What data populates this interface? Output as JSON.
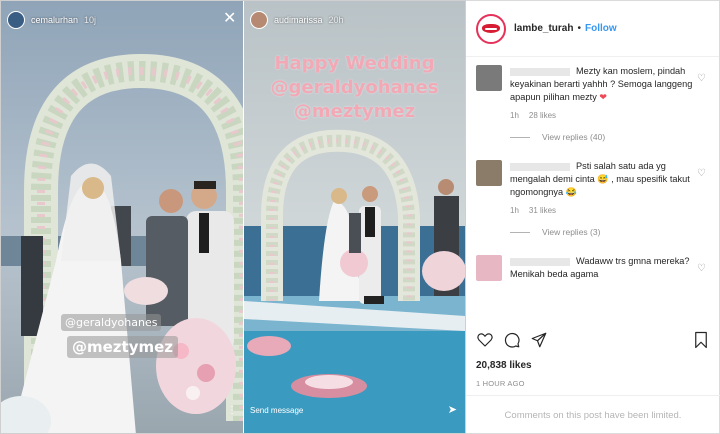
{
  "story_left": {
    "username": "cemalurhan",
    "time": "10j",
    "tag_1": "@geraldyohanes",
    "tag_2": "@meztymez"
  },
  "story_right": {
    "username": "audimarissa",
    "time": "20h",
    "caption_1": "Happy Wedding",
    "caption_2": "@geraldyohanes",
    "caption_3": "@meztymez",
    "send_message": "Send message"
  },
  "post_header": {
    "username": "lambe_turah",
    "separator": "•",
    "follow": "Follow"
  },
  "comments": [
    {
      "text_1": "Mezty kan moslem, pindah keyakinan berarti yahhh ? Semoga langgeng apapun pilihan mezty ",
      "emoji": "❤",
      "time": "1h",
      "likes": "28 likes",
      "replies": "View replies (40)",
      "avatar_color": "#7a7a7a"
    },
    {
      "text_1": "Psti salah satu ada yg mengalah demi cinta ",
      "emoji_a": "😅",
      "text_2": " , mau spesifik takut ngomongnya ",
      "emoji_b": "😂",
      "time": "1h",
      "likes": "31 likes",
      "replies": "View replies (3)",
      "avatar_color": "#8b7c6a"
    },
    {
      "text_1": "Wadaww trs gmna mereka? Menikah beda agama",
      "avatar_color": "#e7b8c4"
    }
  ],
  "likes_count": "20,838 likes",
  "time_ago": "1 HOUR AGO",
  "comments_limited": "Comments on this post have been limited.",
  "colors": {
    "follow_blue": "#3897f0",
    "caption_pink": "#f3a9b5",
    "heart_red": "#ed4956",
    "lips_red": "#d61d33"
  }
}
